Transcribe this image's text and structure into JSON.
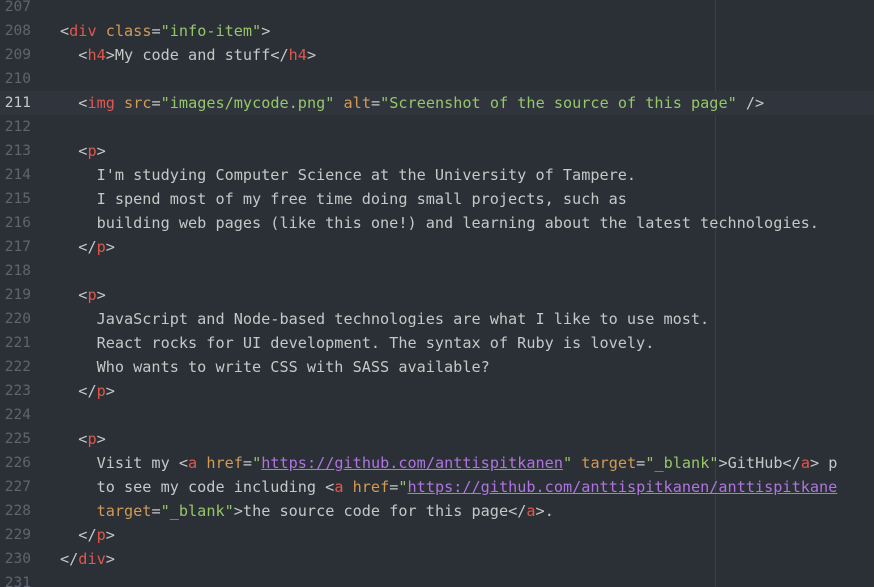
{
  "editor": {
    "lines": [
      {
        "num": "207",
        "tokens": []
      },
      {
        "num": "208",
        "tokens": [
          {
            "t": "",
            "c": "txt"
          },
          {
            "t": "<",
            "c": "punc"
          },
          {
            "t": "div",
            "c": "tag"
          },
          {
            "t": " ",
            "c": "txt"
          },
          {
            "t": "class",
            "c": "attr"
          },
          {
            "t": "=",
            "c": "punc"
          },
          {
            "t": "\"info-item\"",
            "c": "str"
          },
          {
            "t": ">",
            "c": "punc"
          }
        ]
      },
      {
        "num": "209",
        "tokens": [
          {
            "t": "  ",
            "c": "txt"
          },
          {
            "t": "<",
            "c": "punc"
          },
          {
            "t": "h4",
            "c": "tag"
          },
          {
            "t": ">",
            "c": "punc"
          },
          {
            "t": "My code and stuff",
            "c": "txt"
          },
          {
            "t": "</",
            "c": "punc"
          },
          {
            "t": "h4",
            "c": "tag"
          },
          {
            "t": ">",
            "c": "punc"
          }
        ]
      },
      {
        "num": "210",
        "tokens": []
      },
      {
        "num": "211",
        "current": true,
        "tokens": [
          {
            "t": "  ",
            "c": "txt"
          },
          {
            "t": "<",
            "c": "punc"
          },
          {
            "t": "img",
            "c": "tag"
          },
          {
            "t": " ",
            "c": "txt"
          },
          {
            "t": "src",
            "c": "attr"
          },
          {
            "t": "=",
            "c": "punc"
          },
          {
            "t": "\"images/mycode.png\"",
            "c": "str"
          },
          {
            "t": " ",
            "c": "txt"
          },
          {
            "t": "alt",
            "c": "attr"
          },
          {
            "t": "=",
            "c": "punc"
          },
          {
            "t": "\"Screenshot of the source of this page\"",
            "c": "str"
          },
          {
            "t": " />",
            "c": "punc"
          }
        ]
      },
      {
        "num": "212",
        "tokens": []
      },
      {
        "num": "213",
        "tokens": [
          {
            "t": "  ",
            "c": "txt"
          },
          {
            "t": "<",
            "c": "punc"
          },
          {
            "t": "p",
            "c": "tag"
          },
          {
            "t": ">",
            "c": "punc"
          }
        ]
      },
      {
        "num": "214",
        "tokens": [
          {
            "t": "    I'm studying Computer Science at the University of Tampere.",
            "c": "txt"
          }
        ]
      },
      {
        "num": "215",
        "tokens": [
          {
            "t": "    I spend most of my free time doing small projects, such as",
            "c": "txt"
          }
        ]
      },
      {
        "num": "216",
        "tokens": [
          {
            "t": "    building web pages (like this one!) and learning about the latest technologies.",
            "c": "txt"
          }
        ]
      },
      {
        "num": "217",
        "tokens": [
          {
            "t": "  ",
            "c": "txt"
          },
          {
            "t": "</",
            "c": "punc"
          },
          {
            "t": "p",
            "c": "tag"
          },
          {
            "t": ">",
            "c": "punc"
          }
        ]
      },
      {
        "num": "218",
        "tokens": []
      },
      {
        "num": "219",
        "tokens": [
          {
            "t": "  ",
            "c": "txt"
          },
          {
            "t": "<",
            "c": "punc"
          },
          {
            "t": "p",
            "c": "tag"
          },
          {
            "t": ">",
            "c": "punc"
          }
        ]
      },
      {
        "num": "220",
        "tokens": [
          {
            "t": "    JavaScript and Node-based technologies are what I like to use most.",
            "c": "txt"
          }
        ]
      },
      {
        "num": "221",
        "tokens": [
          {
            "t": "    React rocks for UI development. The syntax of Ruby is lovely.",
            "c": "txt"
          }
        ]
      },
      {
        "num": "222",
        "tokens": [
          {
            "t": "    Who wants to write CSS with SASS available?",
            "c": "txt"
          }
        ]
      },
      {
        "num": "223",
        "tokens": [
          {
            "t": "  ",
            "c": "txt"
          },
          {
            "t": "</",
            "c": "punc"
          },
          {
            "t": "p",
            "c": "tag"
          },
          {
            "t": ">",
            "c": "punc"
          }
        ]
      },
      {
        "num": "224",
        "tokens": []
      },
      {
        "num": "225",
        "tokens": [
          {
            "t": "  ",
            "c": "txt"
          },
          {
            "t": "<",
            "c": "punc"
          },
          {
            "t": "p",
            "c": "tag"
          },
          {
            "t": ">",
            "c": "punc"
          }
        ]
      },
      {
        "num": "226",
        "tokens": [
          {
            "t": "    Visit my ",
            "c": "txt"
          },
          {
            "t": "<",
            "c": "punc"
          },
          {
            "t": "a",
            "c": "tag"
          },
          {
            "t": " ",
            "c": "txt"
          },
          {
            "t": "href",
            "c": "attr"
          },
          {
            "t": "=",
            "c": "punc"
          },
          {
            "t": "\"",
            "c": "str"
          },
          {
            "t": "https://github.com/anttispitkanen",
            "c": "url"
          },
          {
            "t": "\"",
            "c": "str"
          },
          {
            "t": " ",
            "c": "txt"
          },
          {
            "t": "target",
            "c": "attr"
          },
          {
            "t": "=",
            "c": "punc"
          },
          {
            "t": "\"_blank\"",
            "c": "str"
          },
          {
            "t": ">",
            "c": "punc"
          },
          {
            "t": "GitHub",
            "c": "txt"
          },
          {
            "t": "</",
            "c": "punc"
          },
          {
            "t": "a",
            "c": "tag"
          },
          {
            "t": ">",
            "c": "punc"
          },
          {
            "t": " p",
            "c": "txt"
          }
        ]
      },
      {
        "num": "227",
        "tokens": [
          {
            "t": "    to see my code including ",
            "c": "txt"
          },
          {
            "t": "<",
            "c": "punc"
          },
          {
            "t": "a",
            "c": "tag"
          },
          {
            "t": " ",
            "c": "txt"
          },
          {
            "t": "href",
            "c": "attr"
          },
          {
            "t": "=",
            "c": "punc"
          },
          {
            "t": "\"",
            "c": "str"
          },
          {
            "t": "https://github.com/anttispitkanen/anttispitkane",
            "c": "url"
          }
        ]
      },
      {
        "num": "228",
        "tokens": [
          {
            "t": "    ",
            "c": "txt"
          },
          {
            "t": "target",
            "c": "attr"
          },
          {
            "t": "=",
            "c": "punc"
          },
          {
            "t": "\"_blank\"",
            "c": "str"
          },
          {
            "t": ">",
            "c": "punc"
          },
          {
            "t": "the source code for this page",
            "c": "txt"
          },
          {
            "t": "</",
            "c": "punc"
          },
          {
            "t": "a",
            "c": "tag"
          },
          {
            "t": ">",
            "c": "punc"
          },
          {
            "t": ".",
            "c": "txt"
          }
        ]
      },
      {
        "num": "229",
        "tokens": [
          {
            "t": "  ",
            "c": "txt"
          },
          {
            "t": "</",
            "c": "punc"
          },
          {
            "t": "p",
            "c": "tag"
          },
          {
            "t": ">",
            "c": "punc"
          }
        ]
      },
      {
        "num": "230",
        "tokens": [
          {
            "t": "",
            "c": "txt"
          },
          {
            "t": "</",
            "c": "punc"
          },
          {
            "t": "div",
            "c": "tag"
          },
          {
            "t": ">",
            "c": "punc"
          }
        ]
      },
      {
        "num": "231",
        "tokens": []
      }
    ]
  }
}
